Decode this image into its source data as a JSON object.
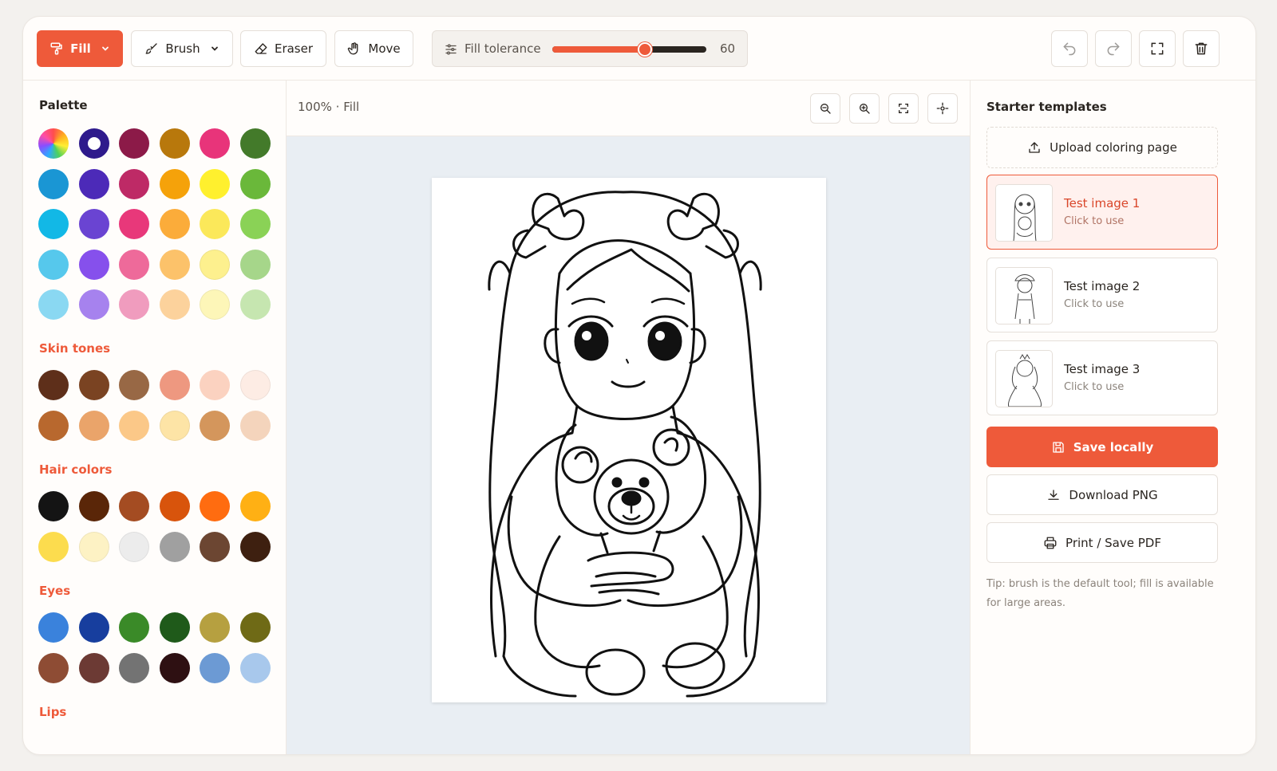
{
  "toolbar": {
    "fill_label": "Fill",
    "brush_label": "Brush",
    "eraser_label": "Eraser",
    "move_label": "Move",
    "tolerance_label": "Fill tolerance",
    "tolerance_value": "60",
    "tolerance_fraction": 0.6
  },
  "palette": {
    "title": "Palette",
    "colors": [
      "rainbow",
      "#2e1a8c",
      "#8c1a48",
      "#b8780c",
      "#e8347a",
      "#437a2a",
      "#1a96d4",
      "#4c2ab8",
      "#be2a66",
      "#f5a20a",
      "#fff02e",
      "#6ab83a",
      "#12b8e6",
      "#6a44d2",
      "#e8387a",
      "#fbac3a",
      "#fbe85a",
      "#8ad256",
      "#56c8ec",
      "#8650ec",
      "#ee6a9a",
      "#fcc26a",
      "#fdf08e",
      "#a6d68a",
      "#8ad8f2",
      "#a682ee",
      "#f09cbe",
      "#fcd29c",
      "#fdf6b8",
      "#c6e6b0"
    ],
    "selected_index": 1
  },
  "skin": {
    "title": "Skin tones",
    "colors": [
      "#5e2f1a",
      "#7a4322",
      "#986845",
      "#ee9880",
      "#fbd2c0",
      "#fdece4",
      "#b8682e",
      "#eaa46a",
      "#fbc888",
      "#fde4a6",
      "#d4965c",
      "#f4d4bc"
    ]
  },
  "hair": {
    "title": "Hair colors",
    "colors": [
      "#141414",
      "#5a2608",
      "#a44c22",
      "#d8540c",
      "#ff6c10",
      "#ffb014",
      "#fcdc4e",
      "#fdf2c4",
      "#ececec",
      "#a0a0a0",
      "#6c4632",
      "#3e2010"
    ]
  },
  "eyes": {
    "title": "Eyes",
    "colors": [
      "#3a82dc",
      "#173e9e",
      "#3a8a28",
      "#1f5a1a",
      "#b6a040",
      "#6f6a16",
      "#8e4c34",
      "#6c3a34",
      "#737373",
      "#2e1012",
      "#6c9ad4",
      "#a8c8ec"
    ]
  },
  "lips": {
    "title": "Lips"
  },
  "canvas": {
    "zoom_label": "100% · Fill"
  },
  "templates": {
    "title": "Starter templates",
    "upload_label": "Upload coloring page",
    "items": [
      {
        "name": "Test image 1",
        "hint": "Click to use"
      },
      {
        "name": "Test image 2",
        "hint": "Click to use"
      },
      {
        "name": "Test image 3",
        "hint": "Click to use"
      }
    ]
  },
  "actions": {
    "save_label": "Save locally",
    "download_label": "Download PNG",
    "print_label": "Print / Save PDF",
    "tip": "Tip: brush is the default tool; fill is available for large areas."
  },
  "colors": {
    "accent": "#ee5a3a",
    "canvas_bg": "#e9eef3"
  }
}
